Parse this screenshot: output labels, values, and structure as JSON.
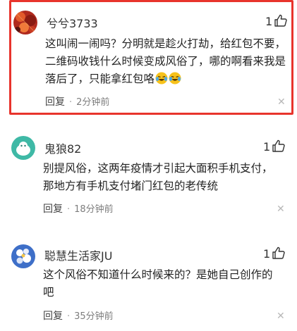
{
  "comments": [
    {
      "username": "兮兮3733",
      "likes": "1",
      "text": "这叫闹一闹吗？分明就是趁火打劫，给红包不要，二维码收钱什么时候变成风俗了，哪的啊看来我是落后了，只能拿红包咯",
      "emojis": [
        "crying-laughing",
        "crying-laughing"
      ],
      "reply_label": "回复",
      "time": "2分钟前",
      "highlighted": true
    },
    {
      "username": "鬼狼82",
      "likes": "1",
      "text": "别提风俗，这两年疫情才引起大面积手机支付，那地方有手机支付堵门红包的老传统",
      "reply_label": "回复",
      "time": "18分钟前",
      "highlighted": false
    },
    {
      "username": "聪慧生活家JU",
      "likes": "1",
      "text": "这个风俗不知道什么时候来的？是她自己创作的吧",
      "reply_label": "回复",
      "time": "35分钟前",
      "highlighted": false
    }
  ],
  "colors": {
    "highlight_border": "#e8342c",
    "meta_text": "#7d7d7d"
  },
  "icons": {
    "like": "thumbs-up-icon",
    "close": "close-icon",
    "emoji": "crying-laughing-emoji"
  }
}
